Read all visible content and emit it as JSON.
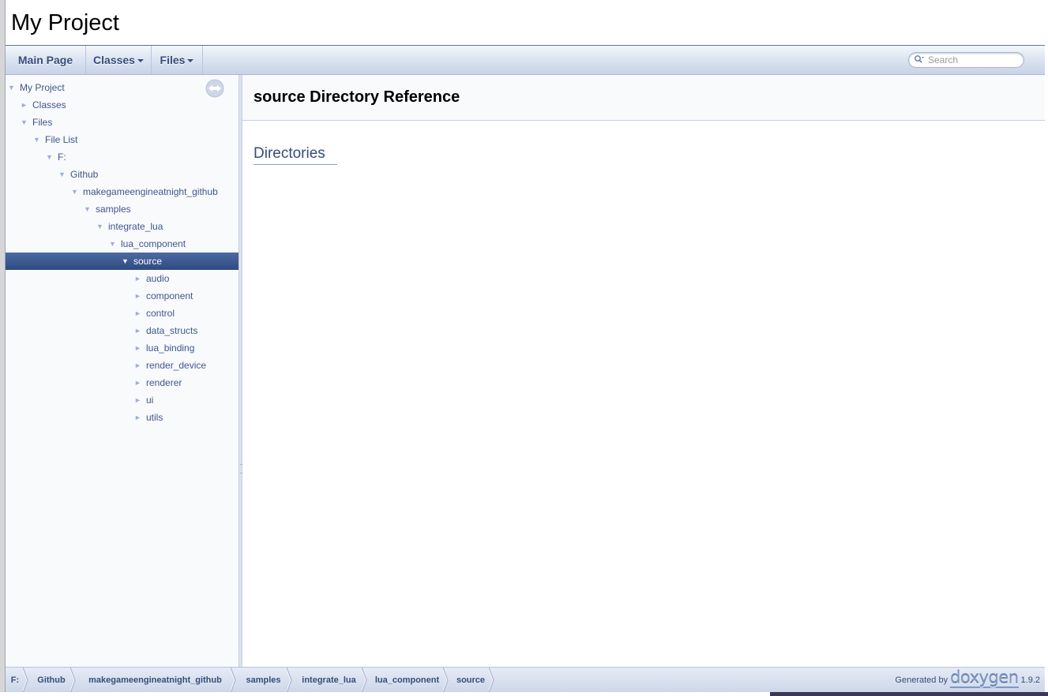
{
  "project": {
    "name": "My Project"
  },
  "navbar": {
    "main_page": "Main Page",
    "classes": "Classes",
    "files": "Files",
    "search_placeholder": "Search"
  },
  "tree": [
    {
      "label": "My Project",
      "arrow": "▼",
      "depth": 0
    },
    {
      "label": "Classes",
      "arrow": "►",
      "depth": 1
    },
    {
      "label": "Files",
      "arrow": "▼",
      "depth": 1
    },
    {
      "label": "File List",
      "arrow": "▼",
      "depth": 2
    },
    {
      "label": "F:",
      "arrow": "▼",
      "depth": 3
    },
    {
      "label": "Github",
      "arrow": "▼",
      "depth": 4
    },
    {
      "label": "makegameengineatnight_github",
      "arrow": "▼",
      "depth": 5
    },
    {
      "label": "samples",
      "arrow": "▼",
      "depth": 6
    },
    {
      "label": "integrate_lua",
      "arrow": "▼",
      "depth": 7
    },
    {
      "label": "lua_component",
      "arrow": "▼",
      "depth": 8
    },
    {
      "label": "source",
      "arrow": "▼",
      "depth": 9,
      "selected": true
    },
    {
      "label": "audio",
      "arrow": "►",
      "depth": 10
    },
    {
      "label": "component",
      "arrow": "►",
      "depth": 10
    },
    {
      "label": "control",
      "arrow": "►",
      "depth": 10
    },
    {
      "label": "data_structs",
      "arrow": "►",
      "depth": 10
    },
    {
      "label": "lua_binding",
      "arrow": "►",
      "depth": 10
    },
    {
      "label": "render_device",
      "arrow": "►",
      "depth": 10
    },
    {
      "label": "renderer",
      "arrow": "►",
      "depth": 10
    },
    {
      "label": "ui",
      "arrow": "►",
      "depth": 10
    },
    {
      "label": "utils",
      "arrow": "►",
      "depth": 10
    }
  ],
  "content": {
    "title": "source Directory Reference",
    "section": "Directories"
  },
  "breadcrumb": [
    "F:",
    "Github",
    "makegameengineatnight_github",
    "samples",
    "integrate_lua",
    "lua_component",
    "source"
  ],
  "footer": {
    "generated_by": "Generated by",
    "logo_text": "doxygen",
    "version": "1.9.2"
  }
}
